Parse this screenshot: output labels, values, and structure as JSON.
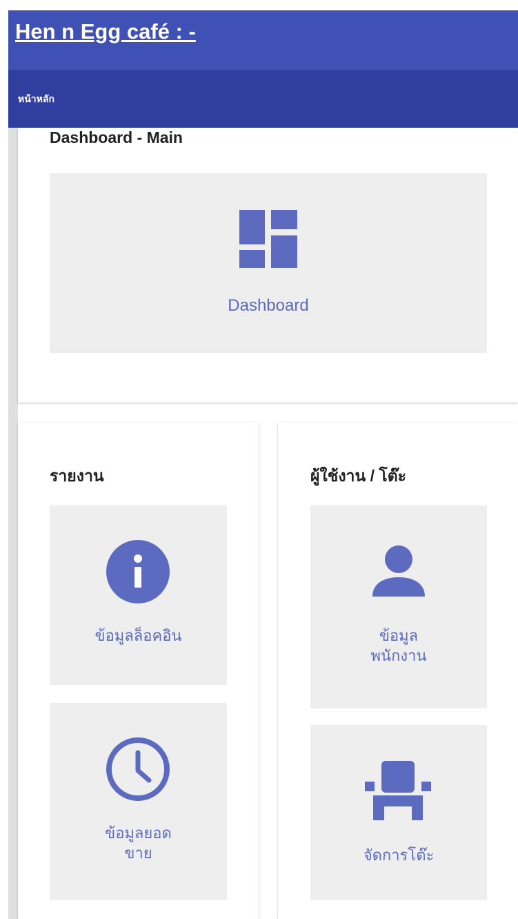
{
  "app": {
    "title": "Hen n Egg café : -"
  },
  "nav": {
    "current": "หน้าหลัก"
  },
  "main": {
    "title": "Dashboard - Main",
    "dashboard_tile": {
      "label": "Dashboard",
      "icon": "dashboard-icon"
    }
  },
  "reports": {
    "title": "รายงาน",
    "tiles": [
      {
        "label": "ข้อมูลล็อคอิน",
        "icon": "info-icon"
      },
      {
        "label": "ข้อมูลยอด\nขาย",
        "icon": "clock-icon"
      }
    ]
  },
  "users": {
    "title": "ผู้ใช้งาน / โต๊ะ",
    "tiles": [
      {
        "label": "ข้อมูล\nพนักงาน",
        "icon": "person-icon"
      },
      {
        "label": "จัดการโต๊ะ",
        "icon": "seat-icon"
      }
    ]
  },
  "colors": {
    "primary": "#3f51b5",
    "primary_dark": "#303f9f",
    "accent": "#5c6bc0",
    "tile_bg": "#eeeeee"
  }
}
